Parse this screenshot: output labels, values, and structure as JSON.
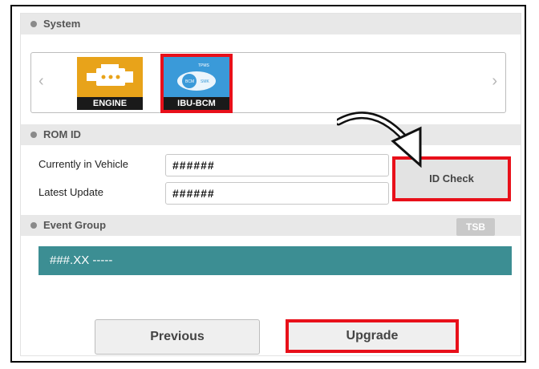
{
  "sections": {
    "system": "System",
    "rom_id": "ROM ID",
    "event_group": "Event Group"
  },
  "modules": [
    {
      "label": "ENGINE",
      "icon": "engine-icon",
      "selected": false
    },
    {
      "label": "IBU-BCM",
      "icon": "ibu-bcm-icon",
      "selected": true,
      "icon_text": {
        "top": "TPMS",
        "left": "BCM",
        "right": "SMK"
      }
    }
  ],
  "rom": {
    "current_label": "Currently in Vehicle",
    "current_value": "######",
    "latest_label": "Latest Update",
    "latest_value": "######",
    "id_check_label": "ID Check"
  },
  "event": {
    "tsb_label": "TSB",
    "item": "###.XX -----"
  },
  "buttons": {
    "previous": "Previous",
    "upgrade": "Upgrade"
  },
  "colors": {
    "highlight": "#e8101a",
    "event_bar": "#3c8e93",
    "engine_tile": "#e8a31a",
    "ibu_tile": "#3a9ad9"
  }
}
